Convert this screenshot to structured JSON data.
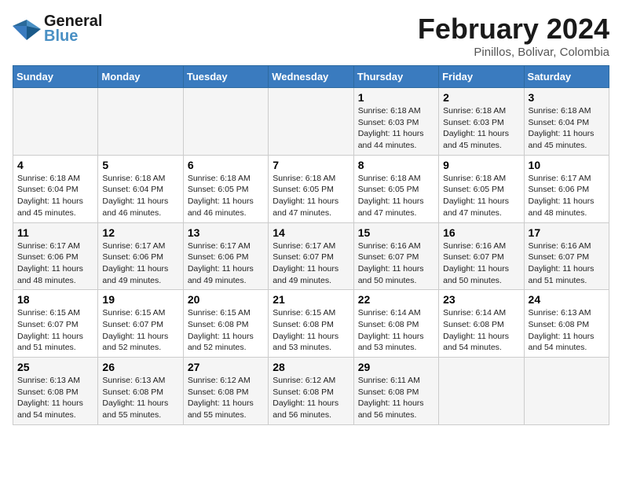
{
  "header": {
    "logo_general": "General",
    "logo_blue": "Blue",
    "month_year": "February 2024",
    "location": "Pinillos, Bolivar, Colombia"
  },
  "days_of_week": [
    "Sunday",
    "Monday",
    "Tuesday",
    "Wednesday",
    "Thursday",
    "Friday",
    "Saturday"
  ],
  "weeks": [
    [
      {
        "day": "",
        "info": ""
      },
      {
        "day": "",
        "info": ""
      },
      {
        "day": "",
        "info": ""
      },
      {
        "day": "",
        "info": ""
      },
      {
        "day": "1",
        "info": "Sunrise: 6:18 AM\nSunset: 6:03 PM\nDaylight: 11 hours\nand 44 minutes."
      },
      {
        "day": "2",
        "info": "Sunrise: 6:18 AM\nSunset: 6:03 PM\nDaylight: 11 hours\nand 45 minutes."
      },
      {
        "day": "3",
        "info": "Sunrise: 6:18 AM\nSunset: 6:04 PM\nDaylight: 11 hours\nand 45 minutes."
      }
    ],
    [
      {
        "day": "4",
        "info": "Sunrise: 6:18 AM\nSunset: 6:04 PM\nDaylight: 11 hours\nand 45 minutes."
      },
      {
        "day": "5",
        "info": "Sunrise: 6:18 AM\nSunset: 6:04 PM\nDaylight: 11 hours\nand 46 minutes."
      },
      {
        "day": "6",
        "info": "Sunrise: 6:18 AM\nSunset: 6:05 PM\nDaylight: 11 hours\nand 46 minutes."
      },
      {
        "day": "7",
        "info": "Sunrise: 6:18 AM\nSunset: 6:05 PM\nDaylight: 11 hours\nand 47 minutes."
      },
      {
        "day": "8",
        "info": "Sunrise: 6:18 AM\nSunset: 6:05 PM\nDaylight: 11 hours\nand 47 minutes."
      },
      {
        "day": "9",
        "info": "Sunrise: 6:18 AM\nSunset: 6:05 PM\nDaylight: 11 hours\nand 47 minutes."
      },
      {
        "day": "10",
        "info": "Sunrise: 6:17 AM\nSunset: 6:06 PM\nDaylight: 11 hours\nand 48 minutes."
      }
    ],
    [
      {
        "day": "11",
        "info": "Sunrise: 6:17 AM\nSunset: 6:06 PM\nDaylight: 11 hours\nand 48 minutes."
      },
      {
        "day": "12",
        "info": "Sunrise: 6:17 AM\nSunset: 6:06 PM\nDaylight: 11 hours\nand 49 minutes."
      },
      {
        "day": "13",
        "info": "Sunrise: 6:17 AM\nSunset: 6:06 PM\nDaylight: 11 hours\nand 49 minutes."
      },
      {
        "day": "14",
        "info": "Sunrise: 6:17 AM\nSunset: 6:07 PM\nDaylight: 11 hours\nand 49 minutes."
      },
      {
        "day": "15",
        "info": "Sunrise: 6:16 AM\nSunset: 6:07 PM\nDaylight: 11 hours\nand 50 minutes."
      },
      {
        "day": "16",
        "info": "Sunrise: 6:16 AM\nSunset: 6:07 PM\nDaylight: 11 hours\nand 50 minutes."
      },
      {
        "day": "17",
        "info": "Sunrise: 6:16 AM\nSunset: 6:07 PM\nDaylight: 11 hours\nand 51 minutes."
      }
    ],
    [
      {
        "day": "18",
        "info": "Sunrise: 6:15 AM\nSunset: 6:07 PM\nDaylight: 11 hours\nand 51 minutes."
      },
      {
        "day": "19",
        "info": "Sunrise: 6:15 AM\nSunset: 6:07 PM\nDaylight: 11 hours\nand 52 minutes."
      },
      {
        "day": "20",
        "info": "Sunrise: 6:15 AM\nSunset: 6:08 PM\nDaylight: 11 hours\nand 52 minutes."
      },
      {
        "day": "21",
        "info": "Sunrise: 6:15 AM\nSunset: 6:08 PM\nDaylight: 11 hours\nand 53 minutes."
      },
      {
        "day": "22",
        "info": "Sunrise: 6:14 AM\nSunset: 6:08 PM\nDaylight: 11 hours\nand 53 minutes."
      },
      {
        "day": "23",
        "info": "Sunrise: 6:14 AM\nSunset: 6:08 PM\nDaylight: 11 hours\nand 54 minutes."
      },
      {
        "day": "24",
        "info": "Sunrise: 6:13 AM\nSunset: 6:08 PM\nDaylight: 11 hours\nand 54 minutes."
      }
    ],
    [
      {
        "day": "25",
        "info": "Sunrise: 6:13 AM\nSunset: 6:08 PM\nDaylight: 11 hours\nand 54 minutes."
      },
      {
        "day": "26",
        "info": "Sunrise: 6:13 AM\nSunset: 6:08 PM\nDaylight: 11 hours\nand 55 minutes."
      },
      {
        "day": "27",
        "info": "Sunrise: 6:12 AM\nSunset: 6:08 PM\nDaylight: 11 hours\nand 55 minutes."
      },
      {
        "day": "28",
        "info": "Sunrise: 6:12 AM\nSunset: 6:08 PM\nDaylight: 11 hours\nand 56 minutes."
      },
      {
        "day": "29",
        "info": "Sunrise: 6:11 AM\nSunset: 6:08 PM\nDaylight: 11 hours\nand 56 minutes."
      },
      {
        "day": "",
        "info": ""
      },
      {
        "day": "",
        "info": ""
      }
    ]
  ]
}
